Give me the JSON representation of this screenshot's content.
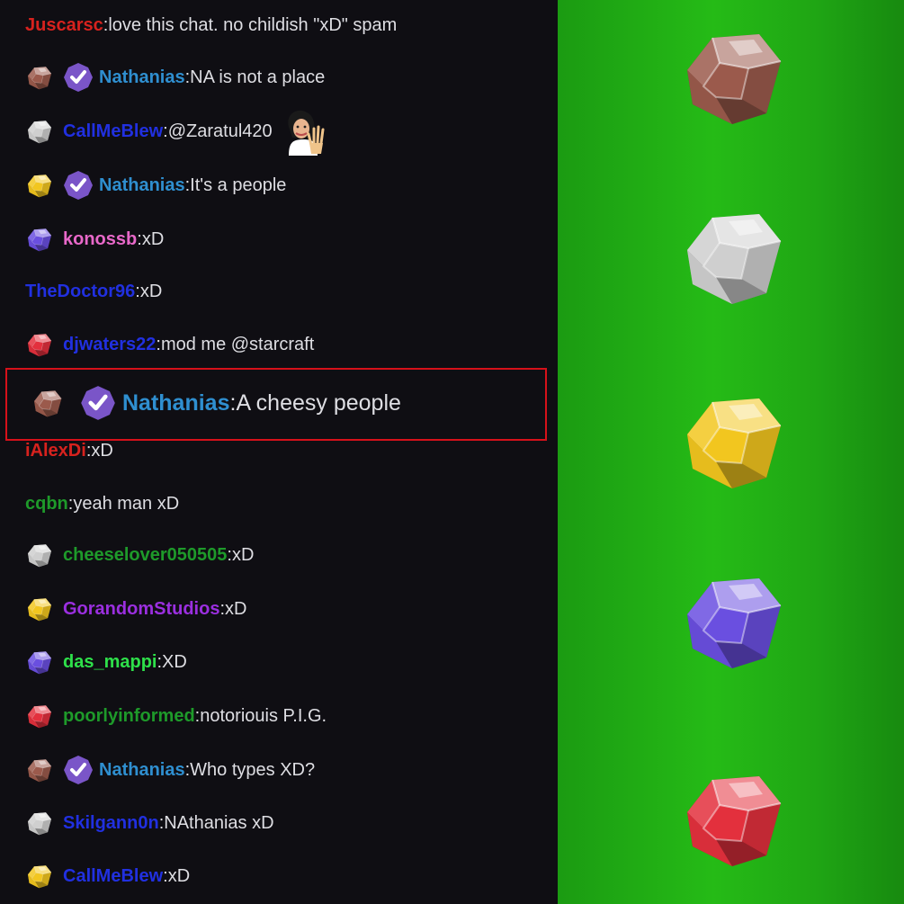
{
  "colors": {
    "chat_bg": "#0f0e13",
    "panel_green": "#25bb16",
    "highlight_border": "#d6111a",
    "message_text": "#dedee3"
  },
  "badge_types": {
    "brown": "#9b5a4c",
    "white": "#cfcfcf",
    "gold": "#f2c61f",
    "purple": "#6a4fe0",
    "red": "#e3303d",
    "verified": "#7a55c8"
  },
  "messages": [
    {
      "badge": null,
      "verified": false,
      "user": "Juscarsc",
      "user_color": "#d7221e",
      "text": "love this chat. no childish \"xD\" spam"
    },
    {
      "badge": "brown",
      "verified": true,
      "user": "Nathanias",
      "user_color": "#2f8fd0",
      "text": "NA is not a place"
    },
    {
      "badge": "white",
      "verified": false,
      "user": "CallMeBlew",
      "user_color": "#2130e0",
      "text": "@Zaratul420",
      "emote": "wave-emote"
    },
    {
      "badge": "gold",
      "verified": true,
      "user": "Nathanias",
      "user_color": "#2f8fd0",
      "text": "It's a people"
    },
    {
      "badge": "purple",
      "verified": false,
      "user": "konossb",
      "user_color": "#e868c9",
      "text": "xD"
    },
    {
      "badge": null,
      "verified": false,
      "user": "TheDoctor96",
      "user_color": "#2130e0",
      "text": "xD"
    },
    {
      "badge": "red",
      "verified": false,
      "user": "djwaters22",
      "user_color": "#2130e0",
      "text": "mod me @starcraft"
    },
    {
      "badge": "brown",
      "verified": true,
      "user": "Nathanias",
      "user_color": "#2f8fd0",
      "text": "A cheesy people",
      "highlighted": true
    },
    {
      "badge": null,
      "verified": false,
      "user": "iAlexDi",
      "user_color": "#d7221e",
      "text": "xD"
    },
    {
      "badge": null,
      "verified": false,
      "user": "cqbn",
      "user_color": "#1e9a2a",
      "text": "yeah man xD"
    },
    {
      "badge": "white",
      "verified": false,
      "user": "cheeselover050505",
      "user_color": "#1e9a2a",
      "text": "xD"
    },
    {
      "badge": "gold",
      "verified": false,
      "user": "GorandomStudios",
      "user_color": "#9b2fe0",
      "text": "xD"
    },
    {
      "badge": "purple",
      "verified": false,
      "user": "das_mappi",
      "user_color": "#2ee04a",
      "text": "XD"
    },
    {
      "badge": "red",
      "verified": false,
      "user": "poorlyinformed",
      "user_color": "#1e9a2a",
      "text": "notoriouis P.I.G."
    },
    {
      "badge": "brown",
      "verified": true,
      "user": "Nathanias",
      "user_color": "#2f8fd0",
      "text": "Who types XD?"
    },
    {
      "badge": "white",
      "verified": false,
      "user": "Skilgann0n",
      "user_color": "#2130e0",
      "text": "NAthanias xD"
    },
    {
      "badge": "gold",
      "verified": false,
      "user": "CallMeBlew",
      "user_color": "#2130e0",
      "text": "xD"
    }
  ],
  "side_gems": [
    "brown",
    "white",
    "gold",
    "purple",
    "red"
  ]
}
